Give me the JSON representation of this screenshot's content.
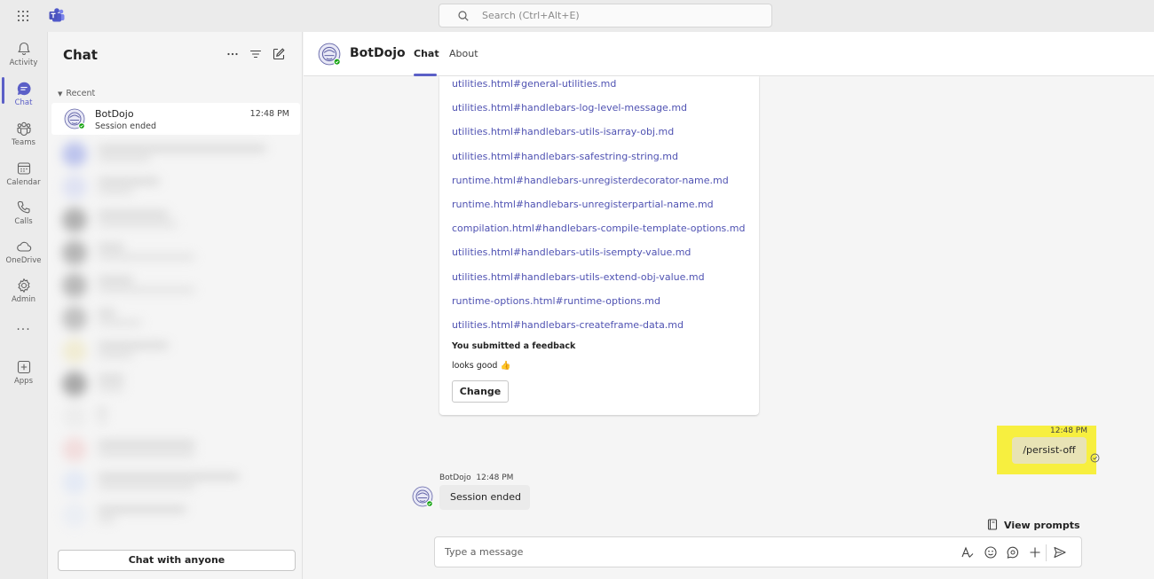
{
  "search": {
    "placeholder": "Search (Ctrl+Alt+E)"
  },
  "rail": [
    {
      "label": "Activity",
      "icon": "bell-icon"
    },
    {
      "label": "Chat",
      "icon": "chat-icon",
      "active": true
    },
    {
      "label": "Teams",
      "icon": "teams-icon"
    },
    {
      "label": "Calendar",
      "icon": "calendar-icon"
    },
    {
      "label": "Calls",
      "icon": "phone-icon"
    },
    {
      "label": "OneDrive",
      "icon": "cloud-icon"
    },
    {
      "label": "Admin",
      "icon": "admin-gear-icon"
    },
    {
      "label": "...",
      "icon": "more-icon"
    },
    {
      "label": "Apps",
      "icon": "add-square-icon"
    }
  ],
  "chat_list": {
    "title": "Chat",
    "section": "Recent",
    "items": [
      {
        "name": "BotDojo",
        "time": "12:48 PM",
        "preview": "Session ended"
      }
    ],
    "chat_with_anyone": "Chat with anyone"
  },
  "header": {
    "name": "BotDojo",
    "tabs": [
      "Chat",
      "About"
    ]
  },
  "card": {
    "links": [
      "utilities.html#general-utilities.md",
      "utilities.html#handlebars-log-level-message.md",
      "utilities.html#handlebars-utils-isarray-obj.md",
      "utilities.html#handlebars-safestring-string.md",
      "runtime.html#handlebars-unregisterdecorator-name.md",
      "runtime.html#handlebars-unregisterpartial-name.md",
      "compilation.html#handlebars-compile-template-options.md",
      "utilities.html#handlebars-utils-isempty-value.md",
      "utilities.html#handlebars-utils-extend-obj-value.md",
      "runtime-options.html#runtime-options.md",
      "utilities.html#handlebars-createframe-data.md"
    ],
    "feedback_title": "You submitted a feedback",
    "feedback_text": "looks good 👍",
    "change_button": "Change"
  },
  "my_message": {
    "time": "12:48 PM",
    "text": "/persist-off"
  },
  "bot_message": {
    "sender": "BotDojo",
    "time": "12:48 PM",
    "text": "Session ended"
  },
  "view_prompts": "View prompts",
  "composer": {
    "placeholder": "Type a message"
  },
  "colors": {
    "brand": "#5b5fc7",
    "link": "#4f52b2",
    "highlight": "#f7ef3f",
    "presence": "#13a10e"
  }
}
